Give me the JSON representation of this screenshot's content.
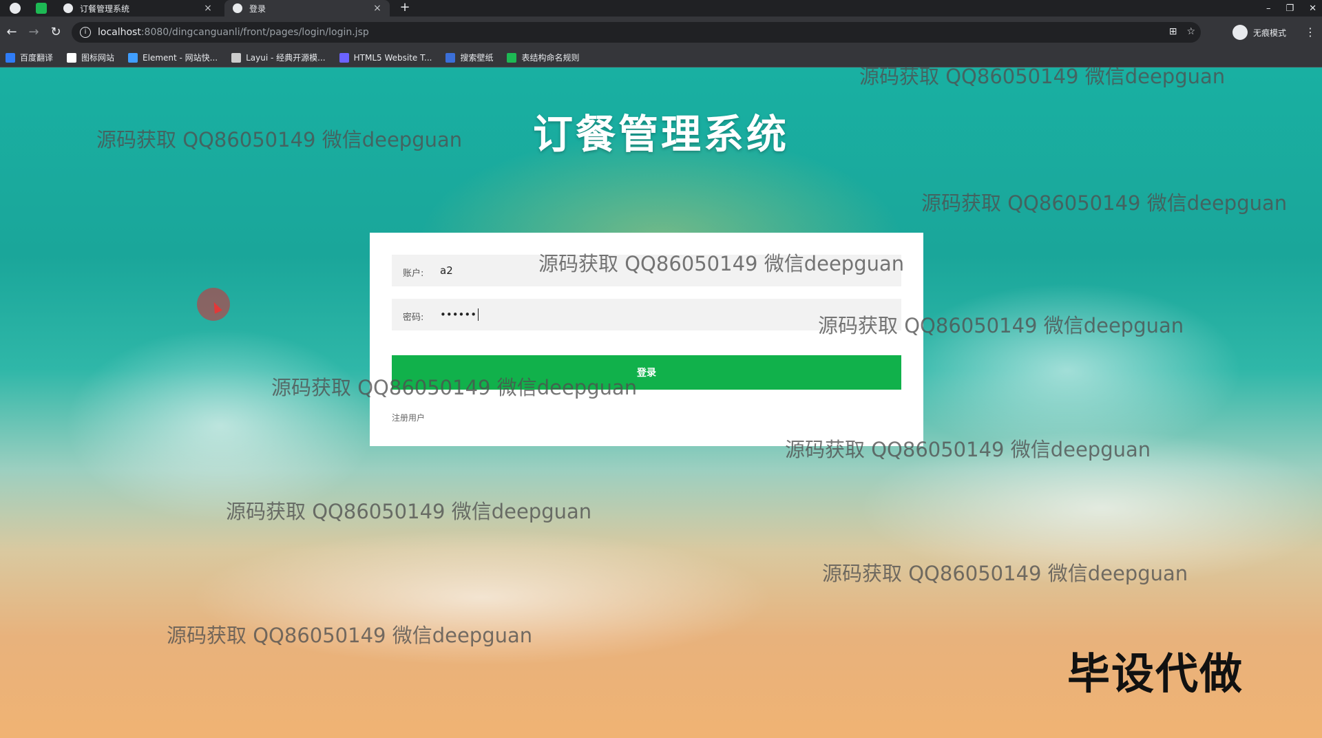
{
  "browser": {
    "tabs": [
      {
        "title": "订餐管理系统",
        "close": "×"
      },
      {
        "title": "登录",
        "close": "×"
      }
    ],
    "new_tab": "+",
    "window_controls": {
      "minimize": "–",
      "restore": "❐",
      "close": "✕"
    },
    "url": {
      "host": "localhost",
      "rest": ":8080/dingcanguanli/front/pages/login/login.jsp"
    },
    "profile_label": "无痕模式",
    "bookmarks": [
      {
        "label": "百度翻译",
        "color": "#2f7cf6"
      },
      {
        "label": "图标网站",
        "color": "#ffffff"
      },
      {
        "label": "Element - 网站快...",
        "color": "#409eff"
      },
      {
        "label": "Layui - 经典开源模...",
        "color": "#cccccc"
      },
      {
        "label": "HTML5 Website T...",
        "color": "#6c63ff"
      },
      {
        "label": "搜索壁纸",
        "color": "#3b6fd8"
      },
      {
        "label": "表结构命名规则",
        "color": "#1db954"
      }
    ]
  },
  "page": {
    "title": "订餐管理系统",
    "login": {
      "account_label": "账户:",
      "account_value": "a2",
      "password_label": "密码:",
      "password_value": "••••••",
      "submit_label": "登录",
      "register_label": "注册用户"
    }
  },
  "watermark_text": "源码获取 QQ86050149 微信deepguan",
  "corner_badge": "毕设代做",
  "colors": {
    "login_button": "#11b14b",
    "card": "#ffffff"
  }
}
